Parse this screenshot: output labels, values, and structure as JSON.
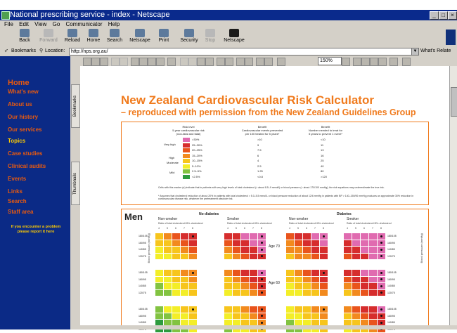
{
  "window": {
    "title": "National prescribing service - index - Netscape",
    "buttons": [
      "_",
      "□",
      "×"
    ]
  },
  "menubar": [
    "File",
    "Edit",
    "View",
    "Go",
    "Communicator",
    "Help"
  ],
  "navbar": {
    "buttons": [
      {
        "label": "Back",
        "icon": "back-arrow-icon",
        "enabled": true
      },
      {
        "label": "Forward",
        "icon": "forward-arrow-icon",
        "enabled": false
      },
      {
        "label": "Reload",
        "icon": "reload-icon",
        "enabled": true
      },
      {
        "label": "Home",
        "icon": "home-icon",
        "enabled": true
      },
      {
        "label": "Search",
        "icon": "search-icon",
        "enabled": true
      },
      {
        "label": "Netscape",
        "icon": "netscape-icon",
        "enabled": true
      },
      {
        "label": "Print",
        "icon": "print-icon",
        "enabled": true
      },
      {
        "label": "Security",
        "icon": "lock-icon",
        "enabled": true
      },
      {
        "label": "Stop",
        "icon": "stop-icon",
        "enabled": false
      },
      {
        "label": "Netscape",
        "icon": "netscape-n-icon",
        "enabled": true
      }
    ]
  },
  "locationbar": {
    "bookmarks_label": "Bookmarks",
    "location_label": "Location:",
    "url": "http://nps.org.au/",
    "whats_related": "What's Relate"
  },
  "sidebar": {
    "items": [
      {
        "label": "Home",
        "active": false
      },
      {
        "label": "What's new",
        "active": false
      },
      {
        "label": "About us",
        "active": false
      },
      {
        "label": "Our history",
        "active": false
      },
      {
        "label": "Our services",
        "active": false
      },
      {
        "label": "Topics",
        "active": true
      },
      {
        "label": "Case studies",
        "active": false
      },
      {
        "label": "Clinical audits",
        "active": false
      },
      {
        "label": "Events",
        "active": false
      },
      {
        "label": "Links",
        "active": false
      },
      {
        "label": "Search",
        "active": false
      },
      {
        "label": "Staff area",
        "active": false
      }
    ],
    "notice": "If you encounter a problem please report it here"
  },
  "pdf": {
    "tabs": [
      "Bookmarks",
      "Thumbnails"
    ],
    "zoom": "150%",
    "title": "New Zealand Cardiovascular Risk Calculator",
    "subtitle": "– reproduced with permission from the New Zealand Guidelines Group",
    "legend": {
      "col1": "Risk level\n5-year cardiovascular risk\n(non-fatal and fatal)",
      "col2": "Benefit\nCardiovascular events prevented\nper 100 treated for 5 years*",
      "col3": "Benefit\nNumber needed to treat for\n5 years to prevent 1 event*",
      "levels": [
        "Very high",
        "High",
        "Moderate",
        "Mild"
      ],
      "rows": [
        {
          "range": ">30%",
          "prevented": ">10",
          "nnt": "<10",
          "color": "#e06bb0"
        },
        {
          "range": "25–30%",
          "prevented": "9",
          "nnt": "11",
          "color": "#d62d2d"
        },
        {
          "range": "20–25%",
          "prevented": "7.5",
          "nnt": "13",
          "color": "#e9541c"
        },
        {
          "range": "15–20%",
          "prevented": "6",
          "nnt": "16",
          "color": "#f28a1e"
        },
        {
          "range": "10–15%",
          "prevented": "4",
          "nnt": "25",
          "color": "#f7c51c"
        },
        {
          "range": "5–10%",
          "prevented": "2.5",
          "nnt": "40",
          "color": "#f3ee28"
        },
        {
          "range": "2.5–5%",
          "prevented": "1.25",
          "nnt": "80",
          "color": "#82c341"
        },
        {
          "range": "<2.5%",
          "prevented": "<0.8",
          "nnt": ">120",
          "color": "#2e9b3e"
        }
      ],
      "footnote1": "Cells with this marker (●) indicate that in patients with very high levels of total cholesterol (> about 8.5–9 mmol/l) or blood pressure (> about 170/100 mmHg), the risk equations may underestimate the true risk.",
      "footnote2": "* Assumes that cholesterol reduction of about 20% in patients with total cholesterol > 5.0–5.5 mmol/L or blood pressure reduction of about 12/6 mmHg in patients with BP > 140–150/90 mmHg produces an approximate 30% reduction in cardiovascular disease risk, whatever the pretreatment absolute risk."
    },
    "men": {
      "label": "Men",
      "groups": [
        "No diabetes",
        "Diabetes"
      ],
      "subgroups": [
        "Non-smoker",
        "Smoker",
        "Non-smoker",
        "Smoker"
      ],
      "ratio_label": "Ratio of total cholesterol:HDL-cholesterol",
      "ratios": [
        "4",
        "5",
        "6",
        "7",
        "8"
      ],
      "bp_labels": [
        "180/105",
        "160/95",
        "140/85",
        "120/75"
      ],
      "bp_axis": "Blood pressure (mmHg)",
      "ages": [
        "Age 70",
        "Age 60"
      ]
    }
  }
}
